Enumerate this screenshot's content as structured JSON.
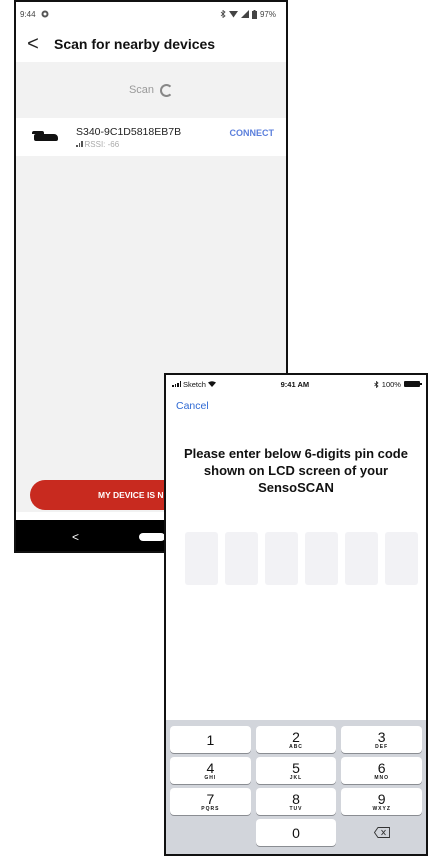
{
  "android": {
    "status": {
      "time": "9:44",
      "battery": "97%"
    },
    "header": {
      "back": "<",
      "title": "Scan for nearby devices"
    },
    "scan": {
      "label": "Scan"
    },
    "device": {
      "name": "S340-9C1D5818EB7B",
      "rssi": "RSSI: -66",
      "action": "CONNECT"
    },
    "bottom_button": "MY DEVICE IS N",
    "nav": {
      "back": "<"
    }
  },
  "ios": {
    "status": {
      "carrier": "Sketch",
      "time": "9:41 AM",
      "battery": "100%"
    },
    "cancel": "Cancel",
    "heading_lines": [
      "Please enter below 6-digits pin code",
      "shown on LCD screen of your",
      "SensoSCAN"
    ],
    "keypad": [
      [
        {
          "num": "1",
          "letters": ""
        },
        {
          "num": "2",
          "letters": "ABC"
        },
        {
          "num": "3",
          "letters": "DEF"
        }
      ],
      [
        {
          "num": "4",
          "letters": "GHI"
        },
        {
          "num": "5",
          "letters": "JKL"
        },
        {
          "num": "6",
          "letters": "MNO"
        }
      ],
      [
        {
          "num": "7",
          "letters": "PQRS"
        },
        {
          "num": "8",
          "letters": "TUV"
        },
        {
          "num": "9",
          "letters": "WXYZ"
        }
      ],
      [
        {
          "num": "",
          "letters": ""
        },
        {
          "num": "0",
          "letters": ""
        },
        {
          "num": "",
          "letters": ""
        }
      ]
    ]
  },
  "colors": {
    "brand_red": "#c82a1f",
    "link_blue": "#2f6ad4",
    "connect_blue": "#5b7fdc"
  }
}
